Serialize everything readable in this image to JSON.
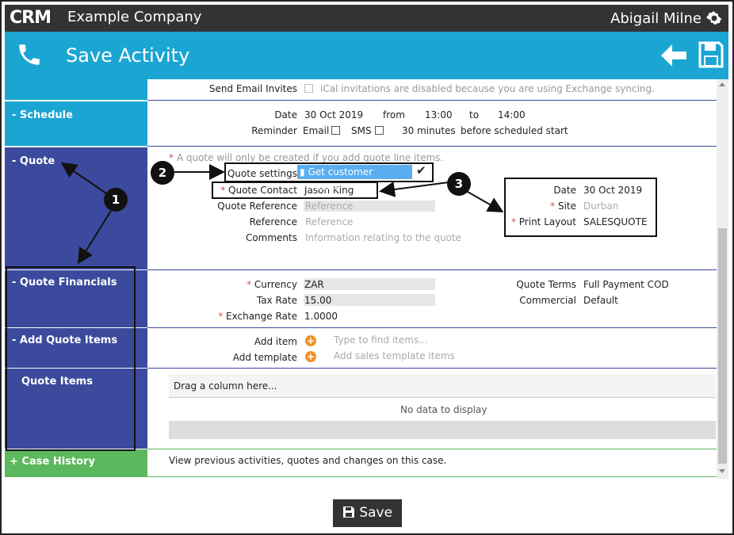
{
  "header": {
    "logo": "CRM",
    "company": "Example Company",
    "user": "Abigail Milne",
    "title": "Save Activity"
  },
  "send_email": {
    "label": "Send Email Invites",
    "note": "iCal invitations are disabled because you are using Exchange syncing."
  },
  "schedule": {
    "section": "Schedule",
    "date_label": "Date",
    "date": "30 Oct 2019",
    "from_label": "from",
    "from": "13:00",
    "to_label": "to",
    "to": "14:00",
    "reminder_label": "Reminder",
    "email_label": "Email",
    "sms_label": "SMS",
    "minutes": "30 minutes",
    "before": "before scheduled start"
  },
  "quote": {
    "section": "Quote",
    "note": "A quote will only be created if you add quote line items.",
    "settings_label": "Quote settings",
    "defaults_button": "Get customer defaults",
    "contact_label": "Quote Contact",
    "contact": "Jason King",
    "quote_ref_label": "Quote Reference",
    "quote_ref_ph": "Reference",
    "ref_label": "Reference",
    "ref_ph": "Reference",
    "comments_label": "Comments",
    "comments_ph": "Information relating to the quote",
    "date_label": "Date",
    "date": "30 Oct 2019",
    "site_label": "Site",
    "site": "Durban",
    "print_label": "Print Layout",
    "print": "SALESQUOTE"
  },
  "financials": {
    "section": "Quote Financials",
    "currency_label": "Currency",
    "currency": "ZAR",
    "tax_label": "Tax Rate",
    "tax": "15.00",
    "exchange_label": "Exchange Rate",
    "exchange": "1.0000",
    "terms_label": "Quote Terms",
    "terms": "Full Payment COD",
    "commercial_label": "Commercial",
    "commercial": "Default"
  },
  "add_items": {
    "section": "Add Quote Items",
    "add_item_label": "Add item",
    "add_item_ph": "Type to find items...",
    "add_template_label": "Add template",
    "add_template_ph": "Add sales template items"
  },
  "quote_items": {
    "section": "Quote Items",
    "drag": "Drag a column here...",
    "empty": "No data to display"
  },
  "case_history": {
    "section": "Case History",
    "desc": "View previous activities, quotes and changes on this case."
  },
  "callouts": [
    "1",
    "2",
    "3"
  ],
  "footer": {
    "save": "Save"
  },
  "colors": {
    "topbar": "#333333",
    "blue": "#1ba5d3",
    "navy": "#3b4a9c",
    "green": "#5cb85c",
    "orange": "#f0932b"
  }
}
